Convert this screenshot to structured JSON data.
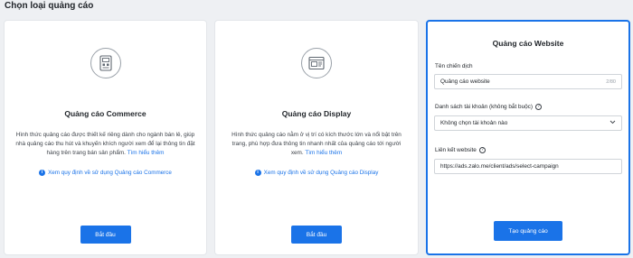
{
  "page": {
    "title": "Chọn loại quảng cáo"
  },
  "cards": [
    {
      "icon": "commerce-icon",
      "title": "Quảng cáo Commerce",
      "description": "Hình thức quảng cáo được thiết kế riêng dành cho ngành bán lẻ, giúp nhà quảng cáo thu hút và khuyến khích người xem để lại thông tin đặt hàng trên trang bán sản phẩm.",
      "learn_more": "Tìm hiểu thêm",
      "policy_link": "Xem quy định về sử dụng Quảng cáo Commerce",
      "button": "Bắt đầu"
    },
    {
      "icon": "display-icon",
      "title": "Quảng cáo Display",
      "description": "Hình thức quảng cáo nằm ở vị trí có kích thước lớn và nổi bật trên trang, phù hợp đưa thông tin nhanh nhất của quảng cáo tới người xem.",
      "learn_more": "Tìm hiểu thêm",
      "policy_link": "Xem quy định về sử dụng Quảng cáo Display",
      "button": "Bắt đầu"
    }
  ],
  "website_form": {
    "title": "Quảng cáo Website",
    "campaign_name": {
      "label": "Tên chiến dịch",
      "value": "Quảng cáo website",
      "counter": "2/80"
    },
    "account_list": {
      "label": "Danh sách tài khoản (không bắt buộc)",
      "value": "Không chọn tài khoản nào"
    },
    "website_link": {
      "label": "Liên kết website",
      "value": "https://ads.zalo.me/client/ads/select-campaign"
    },
    "submit": "Tạo quảng cáo"
  },
  "colors": {
    "accent": "#1a73e8",
    "background": "#eef0f3"
  }
}
